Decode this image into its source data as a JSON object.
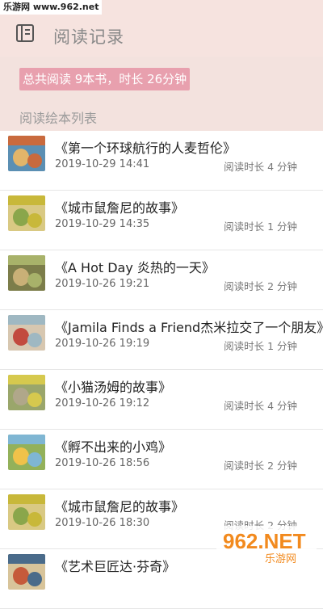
{
  "watermark": "乐游网 www.962.net",
  "header": {
    "title": "阅读记录",
    "icon": "book-icon"
  },
  "summary": "总共阅读 9本书，时长 26分钟",
  "list_title": "阅读绘本列表",
  "records": [
    {
      "title": "《第一个环球航行的人麦哲伦》",
      "date": "2019-10-29 14:41",
      "duration": "阅读时长 4 分钟",
      "cover_colors": [
        "#c96a3d",
        "#e2b56a",
        "#5b8fb3"
      ]
    },
    {
      "title": "《城市鼠詹尼的故事》",
      "date": "2019-10-29 14:35",
      "duration": "阅读时长 1 分钟",
      "cover_colors": [
        "#c8b83a",
        "#8aa64b",
        "#d9c983"
      ]
    },
    {
      "title": "《A Hot Day  炎热的一天》",
      "date": "2019-10-26 19:21",
      "duration": "阅读时长 2 分钟",
      "cover_colors": [
        "#a8b26a",
        "#c9b077",
        "#7c7d4a"
      ]
    },
    {
      "title": "《Jamila Finds a Friend杰米拉交了一个朋友》",
      "date": "2019-10-26 19:19",
      "duration": "阅读时长 1 分钟",
      "cover_colors": [
        "#9fb8c2",
        "#c24a3e",
        "#d7c7b0"
      ]
    },
    {
      "title": "《小猫汤姆的故事》",
      "date": "2019-10-26 19:12",
      "duration": "阅读时长 4 分钟",
      "cover_colors": [
        "#d6c94e",
        "#b0a78a",
        "#9aa66b"
      ]
    },
    {
      "title": "《孵不出来的小鸡》",
      "date": "2019-10-26 18:56",
      "duration": "阅读时长 2 分钟",
      "cover_colors": [
        "#7fb6d3",
        "#f0c24a",
        "#93b15a"
      ]
    },
    {
      "title": "《城市鼠詹尼的故事》",
      "date": "2019-10-26 18:30",
      "duration": "阅读时长 2 分钟",
      "cover_colors": [
        "#c8b83a",
        "#8aa64b",
        "#d9c983"
      ]
    },
    {
      "title": "《艺术巨匠达·芬奇》",
      "date": "",
      "duration": "",
      "cover_colors": [
        "#4a6b8a",
        "#c55a3a",
        "#d8c49a"
      ]
    }
  ],
  "logo": {
    "text": "962.NET",
    "subtext": "乐游网",
    "colors": {
      "primary": "#f28a1e",
      "secondary": "#f6b843"
    }
  }
}
